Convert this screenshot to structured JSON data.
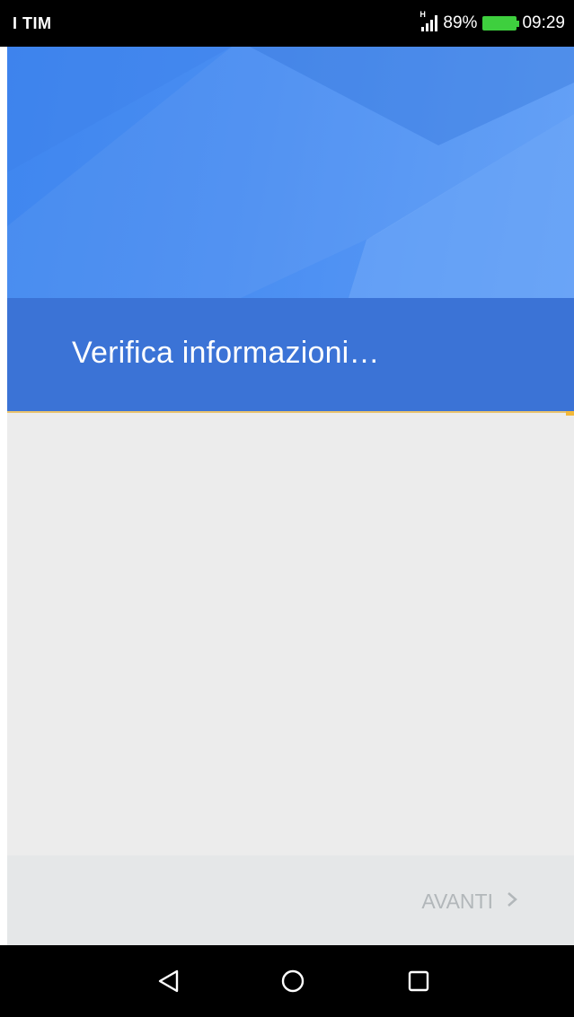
{
  "status_bar": {
    "carrier": "I TIM",
    "network": "H",
    "battery_percent": "89%",
    "time": "09:29",
    "colors": {
      "battery": "#3ecf3e"
    },
    "icons": [
      "signal-icon",
      "battery-icon"
    ]
  },
  "header": {
    "title": "Verifica informazioni…",
    "colors": {
      "hero": "#4a8ef2",
      "title_bar": "#3b73d6",
      "accent": "#f2b83a"
    }
  },
  "footer": {
    "next_label": "AVANTI",
    "next_icon": "chevron-right-icon"
  },
  "nav_bar": {
    "icons": [
      "back-icon",
      "home-icon",
      "recents-icon"
    ]
  }
}
